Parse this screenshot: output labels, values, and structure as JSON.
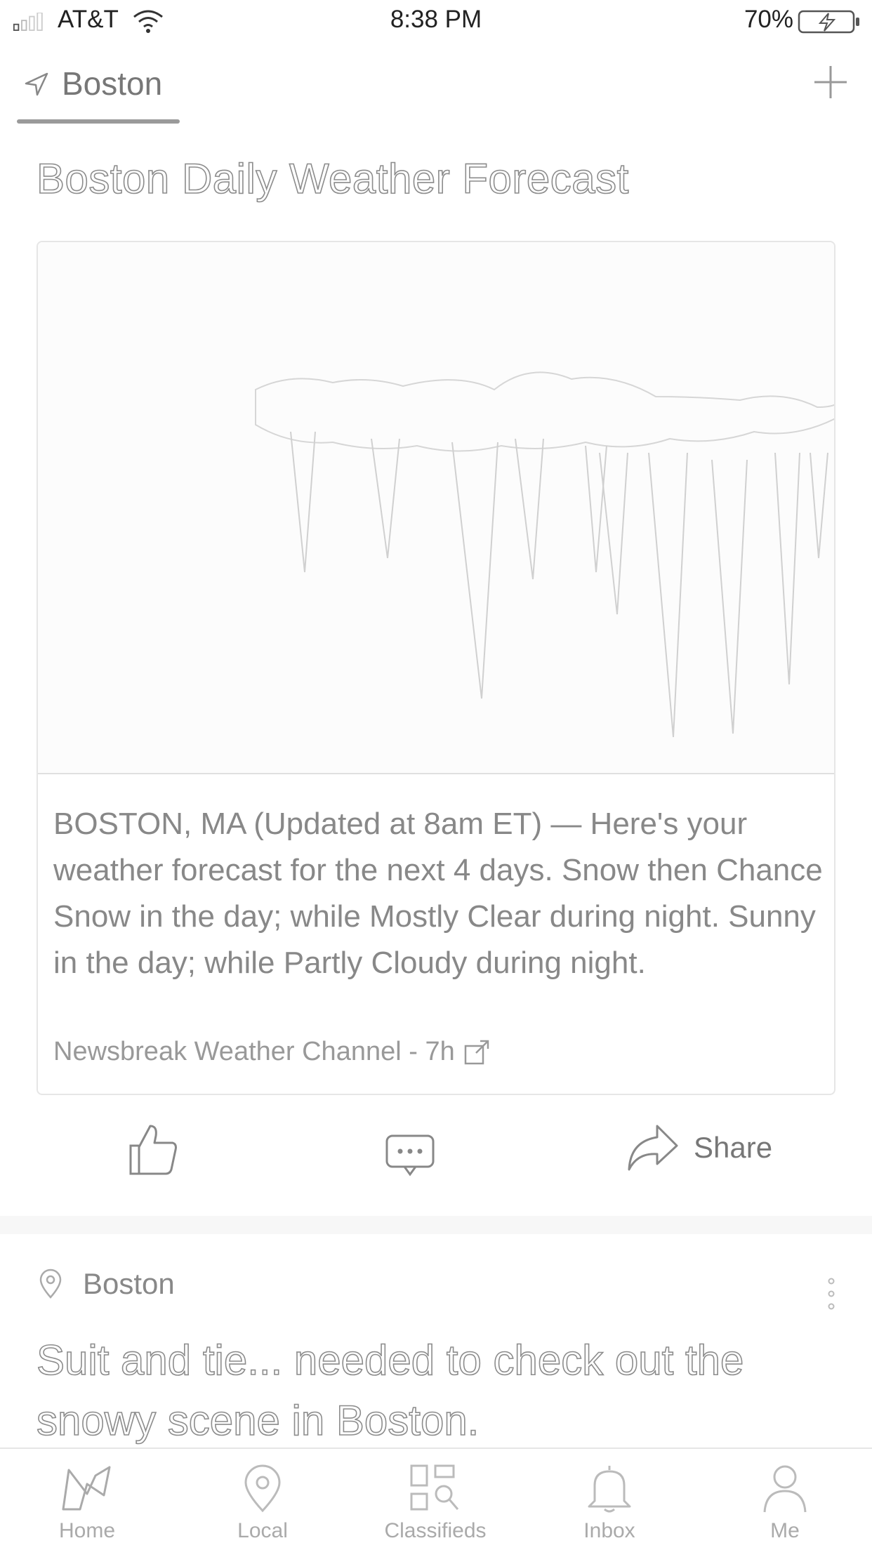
{
  "status_bar": {
    "carrier": "AT&T",
    "time": "8:38 PM",
    "battery": "70%"
  },
  "header": {
    "location_tab": "Boston"
  },
  "article": {
    "headline": "Boston Daily Weather Forecast",
    "summary": "BOSTON, MA (Updated at 8am ET) — Here's your weather forecast for the next 4 days. Snow then Chance Snow in the day; while Mostly Clear during night. Sunny in the day; while Partly Cloudy during night.",
    "source": "Newsbreak Weather Channel - 7h",
    "share_label": "Share"
  },
  "post": {
    "location": "Boston",
    "headline": "Suit and tie... needed to check out the snowy scene in Boston."
  },
  "tabs": [
    {
      "label": "Home",
      "icon": "home-icon"
    },
    {
      "label": "Local",
      "icon": "location-pin-icon"
    },
    {
      "label": "Classifieds",
      "icon": "classifieds-icon"
    },
    {
      "label": "Inbox",
      "icon": "bell-icon"
    },
    {
      "label": "Me",
      "icon": "person-icon"
    }
  ]
}
